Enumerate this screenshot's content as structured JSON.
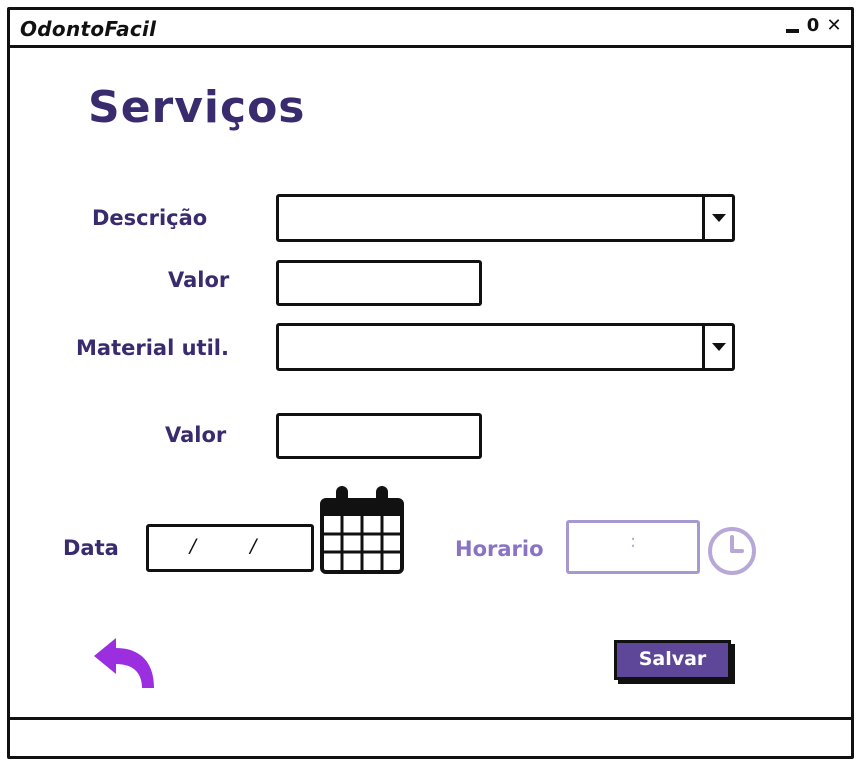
{
  "window": {
    "title": "OdontoFacil",
    "controls": {
      "minimize": "_",
      "maximize": "0",
      "close": "✕"
    }
  },
  "page": {
    "title": "Serviços"
  },
  "form": {
    "descricao_label": "Descrição",
    "descricao_value": "",
    "valor1_label": "Valor",
    "valor1_value": "",
    "material_label": "Material util.",
    "material_value": "",
    "valor2_label": "Valor",
    "valor2_value": "",
    "data_label": "Data",
    "data_value": "/ /",
    "horario_label": "Horario",
    "horario_value": ":"
  },
  "actions": {
    "save_label": "Salvar"
  },
  "icons": {
    "back": "back-arrow-icon",
    "calendar": "calendar-icon",
    "clock": "clock-icon",
    "dropdown": "chevron-down-icon"
  },
  "colors": {
    "primary_text": "#3a2a6e",
    "accent_purple": "#5e4799",
    "back_arrow": "#9b2fe0",
    "disabled_purple": "#b8a8d8"
  }
}
